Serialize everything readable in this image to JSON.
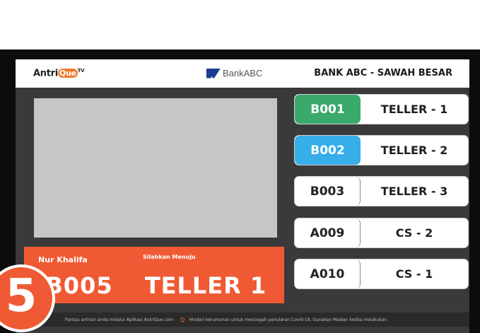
{
  "header": {
    "brand_prefix": "Antri",
    "brand_q": "Que",
    "brand_sup": "TV",
    "bank_name": "BankABC",
    "branch_title": "BANK ABC - SAWAH BESAR"
  },
  "current_call": {
    "customer_name": "Nur Khalifa",
    "queue_number": "B005",
    "prompt": "Silahkan Menuju",
    "destination": "TELLER 1"
  },
  "queue": [
    {
      "code": "B001",
      "destination": "TELLER - 1",
      "status_color": "#3aaa6a"
    },
    {
      "code": "B002",
      "destination": "TELLER - 2",
      "status_color": "#37aee8"
    },
    {
      "code": "B003",
      "destination": "TELLER - 3",
      "status_color": "#ffffff"
    },
    {
      "code": "A009",
      "destination": "CS - 2",
      "status_color": "#ffffff"
    },
    {
      "code": "A010",
      "destination": "CS - 1",
      "status_color": "#ffffff"
    }
  ],
  "ticker": {
    "message_1": "Pantau antrian anda melalui Aplikasi AntriQue.com",
    "message_2": "Hindari kerumunan untuk mencegah penularan Covid-19, Gunakan Masker ketika melakukan"
  },
  "badge": {
    "number": "5"
  },
  "colors": {
    "accent": "#ef5a34",
    "active_green": "#3aaa6a",
    "active_blue": "#37aee8",
    "bank_blue": "#1a3d8f"
  }
}
